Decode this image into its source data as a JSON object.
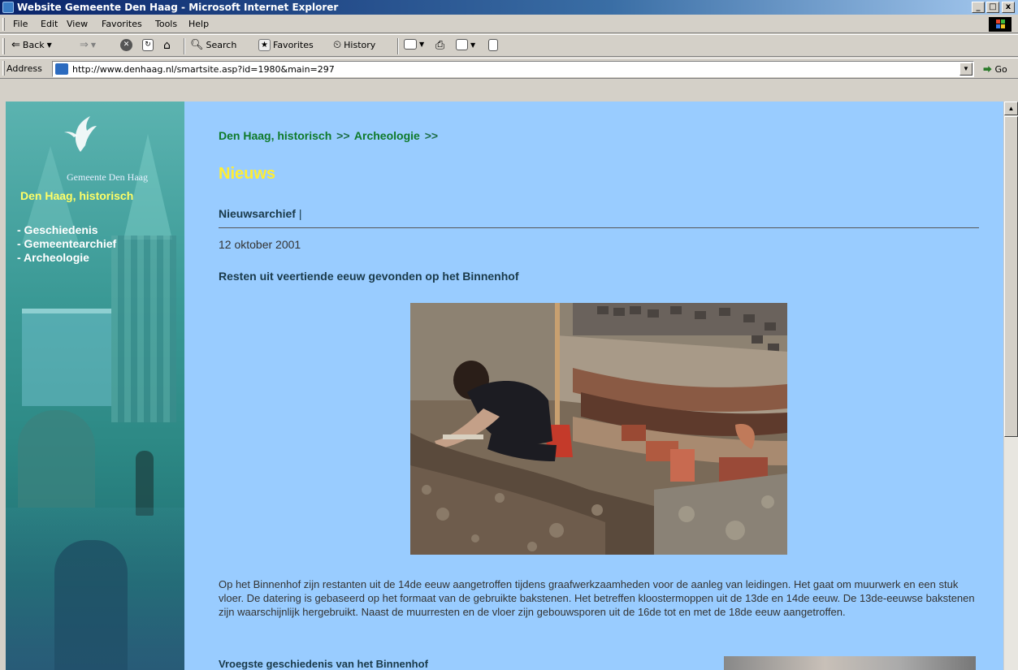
{
  "window": {
    "title": "Website Gemeente Den Haag - Microsoft Internet Explorer",
    "minimize": "_",
    "maximize": "□",
    "close": "x"
  },
  "menu": {
    "items": [
      "File",
      "Edit",
      "View",
      "Favorites",
      "Tools",
      "Help"
    ]
  },
  "toolbar": {
    "back": "Back",
    "search": "Search",
    "favorites": "Favorites",
    "history": "History"
  },
  "address": {
    "label": "Address",
    "url": "http://www.denhaag.nl/smartsite.asp?id=1980&main=297",
    "go": "Go"
  },
  "sidebar": {
    "gemeente": "Gemeente Den Haag",
    "section": "Den Haag, historisch",
    "nav": [
      "- Geschiedenis",
      "- Gemeentearchief",
      "- Archeologie"
    ]
  },
  "content": {
    "breadcrumb": {
      "level1": "Den Haag, historisch",
      "sep1": ">>",
      "level2": "Archeologie",
      "sep2": ">>"
    },
    "page_title": "Nieuws",
    "archive_link": "Nieuwsarchief",
    "archive_sep": "|",
    "date": "12 oktober 2001",
    "headline": "Resten uit veertiende eeuw gevonden op het Binnenhof",
    "body": "Op het Binnenhof zijn restanten uit de 14de eeuw aangetroffen tijdens graafwerkzaamheden voor de aanleg van leidingen. Het gaat om muurwerk en een stuk vloer. De datering is gebaseerd op het formaat van de gebruikte bakstenen. Het betreffen kloostermoppen uit de 13de en 14de eeuw. De 13de-eeuwse bakstenen zijn waarschijnlijk hergebruikt. Naast de muurresten en de vloer zijn gebouwsporen uit de 16de tot en met de 18de eeuw aangetroffen.",
    "subhead": "Vroegste geschiedenis van het Binnenhof"
  },
  "colors": {
    "page_bg": "#99ccff",
    "title_yellow": "#ffee33",
    "breadcrumb_green": "#0f7a2a",
    "sidebar_teal": "#3a9995"
  }
}
